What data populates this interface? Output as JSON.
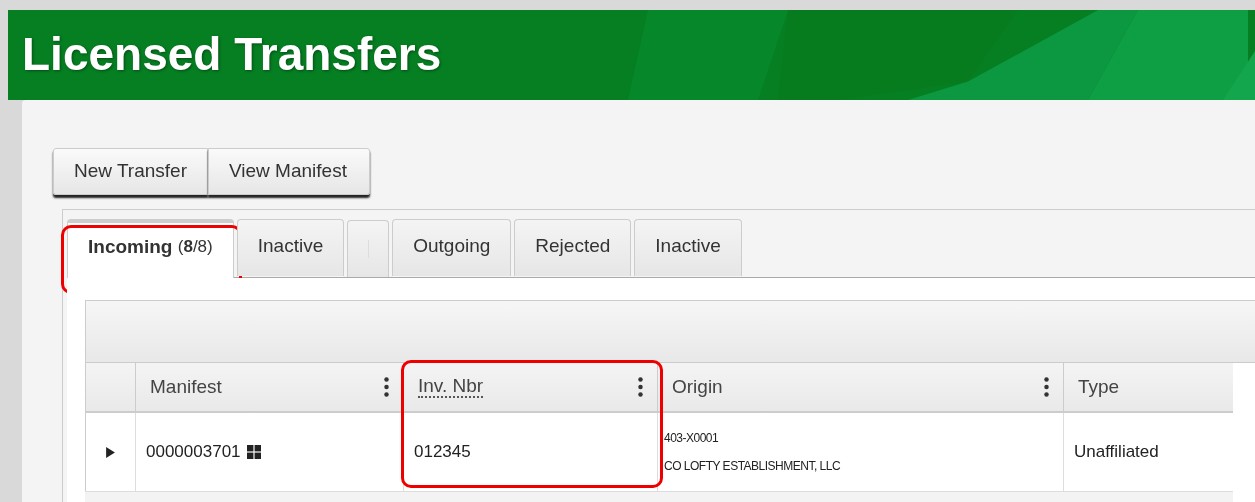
{
  "page": {
    "title": "Licensed Transfers"
  },
  "buttons": [
    "New Transfer",
    "View Manifest"
  ],
  "tabs": [
    {
      "kind": "tab",
      "label": "Incoming",
      "count": "(**8**/8)",
      "selected": true,
      "highlighted": true
    },
    {
      "kind": "tab",
      "label": "Inactive",
      "selected": false,
      "highlighted": false
    },
    {
      "kind": "separator"
    },
    {
      "kind": "tab",
      "label": "Outgoing",
      "selected": false,
      "highlighted": false
    },
    {
      "kind": "tab",
      "label": "Rejected",
      "selected": false,
      "highlighted": false
    },
    {
      "kind": "tab",
      "label": "Inactive",
      "selected": false,
      "highlighted": false
    }
  ],
  "table": {
    "columns": [
      {
        "label": "Manifest",
        "menu": true,
        "tooltip": false,
        "highlighted": false
      },
      {
        "label": "Inv. Nbr",
        "menu": true,
        "tooltip": true,
        "highlighted": true
      },
      {
        "label": "Origin",
        "menu": true,
        "tooltip": false,
        "highlighted": false
      },
      {
        "label": "Type",
        "menu": false,
        "tooltip": false,
        "highlighted": false
      }
    ],
    "rows": [
      {
        "expanded": false,
        "manifest": "0000003701",
        "inv_nbr": "012345",
        "origin_license": "403-X0001",
        "origin_name": "CO LOFTY ESTABLISHMENT, LLC",
        "type": "Unaffiliated"
      }
    ]
  }
}
